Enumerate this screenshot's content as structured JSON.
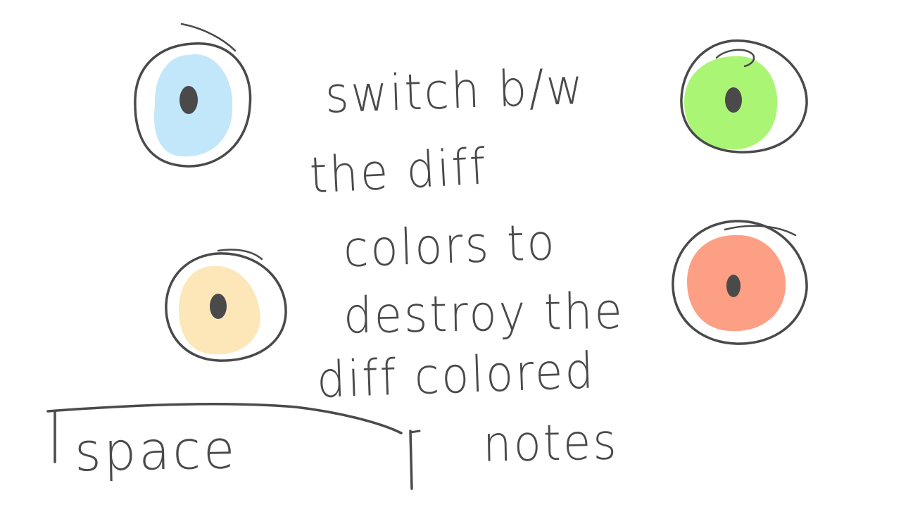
{
  "instruction_lines": [
    "switch b/w",
    "the diff",
    "colors to",
    "destroy the",
    "diff colored",
    "notes"
  ],
  "space_key": {
    "label": "space"
  },
  "notes": [
    {
      "color_name": "light-blue",
      "fill": "#bfe6fb"
    },
    {
      "color_name": "green",
      "fill": "#a6f46e"
    },
    {
      "color_name": "yellow",
      "fill": "#fde6b4"
    },
    {
      "color_name": "red",
      "fill": "#fd9a7d"
    }
  ],
  "colors": {
    "ink": "#4a4a4a",
    "background": "#ffffff"
  }
}
